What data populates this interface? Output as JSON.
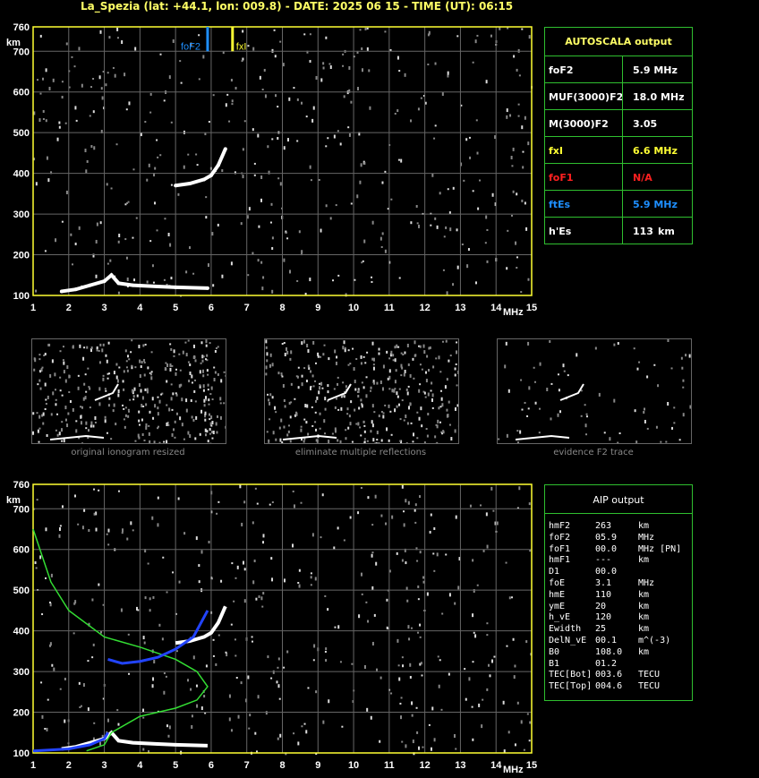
{
  "header": {
    "title": "La_Spezia (lat: +44.1, lon: 009.8) - DATE: 2025 06 15 - TIME (UT): 06:15"
  },
  "chart_data": [
    {
      "type": "scatter",
      "title": "",
      "xlabel": "MHz",
      "ylabel": "km",
      "xlim": [
        1,
        15
      ],
      "ylim": [
        100,
        760
      ],
      "x_ticks": [
        "1",
        "2",
        "3",
        "4",
        "5",
        "6",
        "7",
        "8",
        "9",
        "10",
        "11",
        "12",
        "13",
        "14",
        "15"
      ],
      "y_ticks": [
        "100",
        "200",
        "300",
        "400",
        "500",
        "600",
        "700",
        "760"
      ],
      "grid": true,
      "markers": [
        {
          "label": "foF2",
          "x": 5.9,
          "color": "#1e8fff"
        },
        {
          "label": "fxI",
          "x": 6.6,
          "color": "#ffff33"
        }
      ],
      "traces": [
        {
          "name": "E",
          "points": [
            [
              1.8,
              110
            ],
            [
              2.2,
              115
            ],
            [
              2.6,
              125
            ],
            [
              3.0,
              135
            ],
            [
              3.2,
              150
            ],
            [
              3.4,
              130
            ],
            [
              3.8,
              125
            ],
            [
              4.5,
              122
            ],
            [
              5.0,
              120
            ],
            [
              5.9,
              118
            ]
          ]
        },
        {
          "name": "F2",
          "points": [
            [
              5.0,
              370
            ],
            [
              5.4,
              375
            ],
            [
              5.8,
              385
            ],
            [
              6.0,
              395
            ],
            [
              6.2,
              420
            ],
            [
              6.4,
              460
            ]
          ]
        }
      ]
    },
    {
      "type": "line",
      "title": "",
      "xlabel": "MHz",
      "ylabel": "km",
      "xlim": [
        1,
        15
      ],
      "ylim": [
        100,
        760
      ],
      "x_ticks": [
        "1",
        "2",
        "3",
        "4",
        "5",
        "6",
        "7",
        "8",
        "9",
        "10",
        "11",
        "12",
        "13",
        "14",
        "15"
      ],
      "y_ticks": [
        "100",
        "200",
        "300",
        "400",
        "500",
        "600",
        "700",
        "760"
      ],
      "grid": true,
      "series": [
        {
          "color": "#33dd33",
          "points": [
            [
              1.0,
              650
            ],
            [
              1.5,
              520
            ],
            [
              2.0,
              450
            ],
            [
              3.0,
              385
            ],
            [
              4.0,
              360
            ],
            [
              5.0,
              330
            ],
            [
              5.6,
              300
            ],
            [
              5.9,
              263
            ],
            [
              5.6,
              230
            ],
            [
              5.0,
              210
            ],
            [
              4.0,
              190
            ],
            [
              3.2,
              150
            ],
            [
              3.0,
              120
            ],
            [
              2.5,
              105
            ]
          ]
        },
        {
          "color": "#2244ff",
          "points": [
            [
              3.1,
              330
            ],
            [
              3.5,
              320
            ],
            [
              4.0,
              325
            ],
            [
              4.5,
              335
            ],
            [
              5.0,
              355
            ],
            [
              5.5,
              385
            ],
            [
              5.9,
              450
            ]
          ]
        },
        {
          "color": "#2244ff",
          "points": [
            [
              1.0,
              105
            ],
            [
              2.0,
              110
            ],
            [
              2.6,
              120
            ],
            [
              3.0,
              135
            ],
            [
              3.1,
              150
            ]
          ]
        }
      ]
    }
  ],
  "autoscala": {
    "title": "AUTOSCALA output",
    "rows": [
      {
        "key": "foF2",
        "value": "5.9 MHz",
        "color": "#ffffff"
      },
      {
        "key": "MUF(3000)F2",
        "value": "18.0 MHz",
        "color": "#ffffff"
      },
      {
        "key": "M(3000)F2",
        "value": "3.05",
        "color": "#ffffff"
      },
      {
        "key": "fxI",
        "value": "6.6 MHz",
        "color": "#ffff33"
      },
      {
        "key": "foF1",
        "value": "N/A",
        "color": "#ff2020"
      },
      {
        "key": "ftEs",
        "value": "5.9 MHz",
        "color": "#1e8fff"
      },
      {
        "key": "h'Es",
        "value": "113",
        "unit": "km",
        "color": "#ffffff"
      }
    ]
  },
  "thumbs": [
    {
      "caption": "original ionogram resized"
    },
    {
      "caption": "eliminate multiple reflections"
    },
    {
      "caption": "evidence F2 trace"
    }
  ],
  "aip": {
    "title": "AIP output",
    "rows": [
      {
        "k": "hmF2",
        "v": "263",
        "u": "km"
      },
      {
        "k": "foF2",
        "v": "05.9",
        "u": "MHz"
      },
      {
        "k": "foF1",
        "v": "00.0",
        "u": "MHz  [PN]"
      },
      {
        "k": "hmF1",
        "v": "---",
        "u": "km"
      },
      {
        "k": "D1",
        "v": "00.0",
        "u": ""
      },
      {
        "k": "foE",
        "v": "3.1",
        "u": "MHz"
      },
      {
        "k": "hmE",
        "v": "110",
        "u": "km"
      },
      {
        "k": "ymE",
        "v": "20",
        "u": "km"
      },
      {
        "k": "h_vE",
        "v": "120",
        "u": "km"
      },
      {
        "k": "Ewidth",
        "v": "25",
        "u": "km"
      },
      {
        "k": "DelN_vE",
        "v": "00.1",
        "u": "m^(-3)"
      },
      {
        "k": "B0",
        "v": "108.0",
        "u": "km"
      },
      {
        "k": "B1",
        "v": "01.2",
        "u": ""
      },
      {
        "k": "TEC[Bot]",
        "v": "003.6",
        "u": "TECU"
      },
      {
        "k": "TEC[Top]",
        "v": "004.6",
        "u": "TECU"
      }
    ]
  }
}
